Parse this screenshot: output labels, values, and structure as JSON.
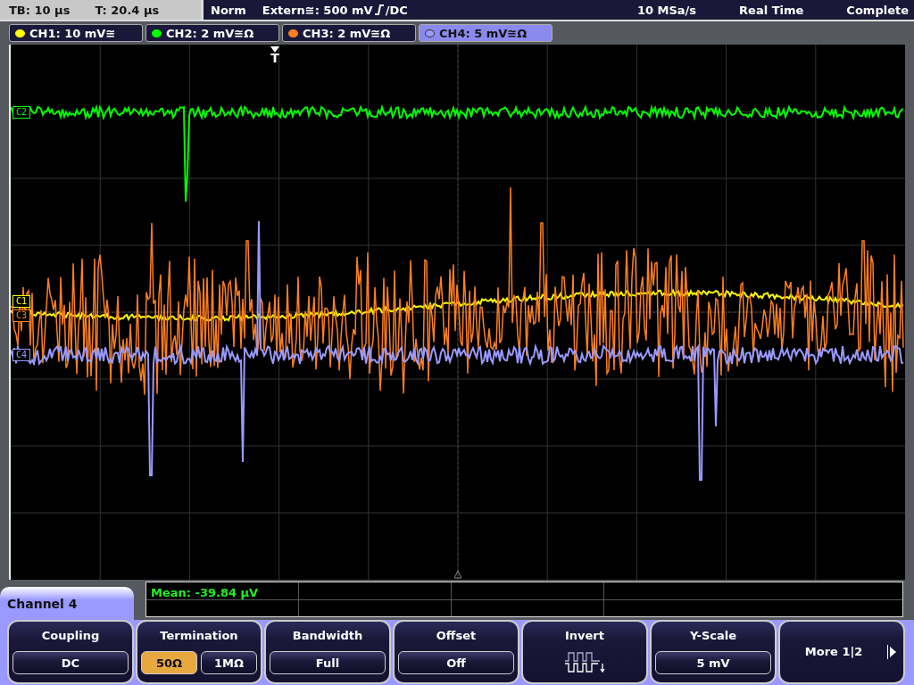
{
  "status_bar": {
    "timebase": "TB: 10 µs",
    "trigger_time": "T: 20.4 µs",
    "mode": "Norm",
    "trigger_source": "Extern≅: 500 mV",
    "trigger_coupling": "/DC",
    "sample_rate": "10 MSa/s",
    "acquisition": "Real Time",
    "status": "Complete"
  },
  "channel_tabs": [
    {
      "label": "CH1: 10 mV≅",
      "color": "#ffff00",
      "selected": false
    },
    {
      "label": "CH2: 2 mV≅Ω",
      "color": "#00ff00",
      "selected": false
    },
    {
      "label": "CH3: 2 mV≅Ω",
      "color": "#ff7f20",
      "selected": false
    },
    {
      "label": "CH4: 5 mV≅Ω",
      "color": "#9a9aff",
      "selected": true
    }
  ],
  "channel_markers": [
    {
      "label": "C2",
      "color": "#00ff00"
    },
    {
      "label": "C1",
      "color": "#ffff00"
    },
    {
      "label": "C3",
      "color": "#ff7f20"
    },
    {
      "label": "C4",
      "color": "#9a9aff"
    }
  ],
  "trigger_marker": "T",
  "measurement": "Mean: -39.84 µV",
  "menu_title": "Channel 4",
  "softkeys": [
    {
      "kind": "value",
      "title": "Coupling",
      "value": "DC"
    },
    {
      "kind": "options",
      "title": "Termination",
      "options": [
        {
          "label": "50Ω",
          "selected": true
        },
        {
          "label": "1MΩ",
          "selected": false
        }
      ]
    },
    {
      "kind": "value",
      "title": "Bandwidth",
      "value": "Full"
    },
    {
      "kind": "value",
      "title": "Offset",
      "value": "Off"
    },
    {
      "kind": "icon",
      "title": "Invert"
    },
    {
      "kind": "value",
      "title": "Y-Scale",
      "value": "5 mV"
    },
    {
      "kind": "more",
      "title": "More 1|2"
    }
  ]
}
